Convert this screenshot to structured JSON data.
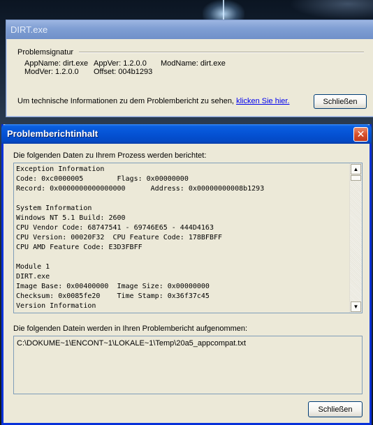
{
  "back_window": {
    "title": "DIRT.exe",
    "group_label": "Problemsignatur",
    "signature": {
      "appname": "AppName: dirt.exe",
      "appver": "AppVer: 1.2.0.0",
      "modname": "ModName: dirt.exe",
      "modver": "ModVer: 1.2.0.0",
      "offset": "Offset: 004b1293"
    },
    "info_text": "Um technische Informationen zu dem Problembericht zu sehen,",
    "link_text": "klicken Sie hier.",
    "close_label": "Schließen"
  },
  "front_window": {
    "title": "Problemberichtinhalt",
    "label_data": "Die folgenden Daten zu Ihrem Prozess werden berichtet:",
    "report_lines": [
      "Exception Information",
      "Code: 0xc0000005        Flags: 0x00000000",
      "Record: 0x0000000000000000      Address: 0x00000000008b1293",
      "",
      "System Information",
      "Windows NT 5.1 Build: 2600",
      "CPU Vendor Code: 68747541 - 69746E65 - 444D4163",
      "CPU Version: 00020F32  CPU Feature Code: 178BFBFF",
      "CPU AMD Feature Code: E3D3FBFF",
      "",
      "Module 1",
      "DIRT.exe",
      "Image Base: 0x00400000  Image Size: 0x00000000",
      "Checksum: 0x0085fe20    Time Stamp: 0x36f37c45",
      "Version Information"
    ],
    "label_files": "Die folgenden Datein werden in Ihren Problembericht aufgenommen:",
    "file_path": "C:\\DOKUME~1\\ENCONT~1\\LOKALE~1\\Temp\\20a5_appcompat.txt",
    "close_label": "Schließen",
    "close_icon_glyph": "✕"
  },
  "scrollbar_glyphs": {
    "up": "▲",
    "down": "▼"
  },
  "colors": {
    "titlebar_active": "#0552d4",
    "window_face": "#ece9d8",
    "link": "#0000ee",
    "close_red": "#d9512c"
  }
}
